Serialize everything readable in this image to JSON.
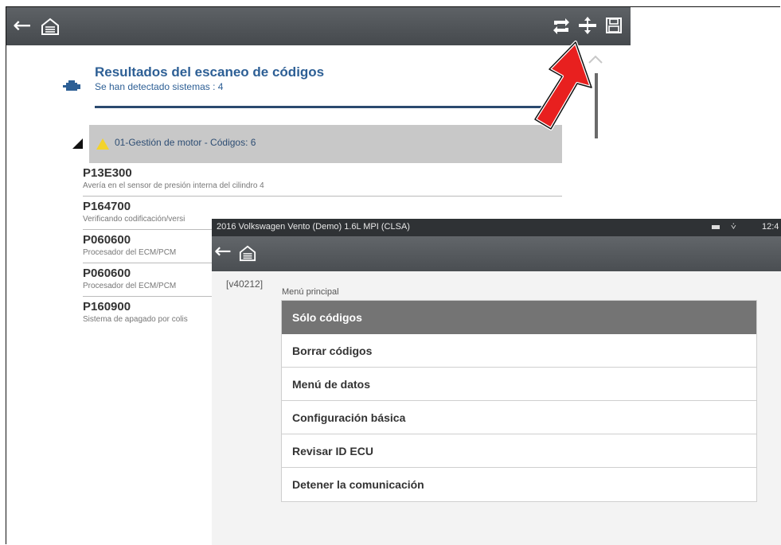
{
  "background_screen": {
    "toolbar": {
      "back_icon": "back-arrow-icon",
      "home_icon": "home-icon",
      "right_icons": [
        "refresh-icon",
        "expand-icon",
        "save-icon"
      ]
    },
    "scan": {
      "title": "Resultados del escaneo de códigos",
      "subtitle": "Se han detectado sistemas : 4"
    },
    "system": {
      "label": "01-Gestión de motor  - Códigos: 6"
    },
    "codes": [
      {
        "code": "P13E300",
        "desc": "Avería en el sensor de presión interna del cilindro 4"
      },
      {
        "code": "P164700",
        "desc": "Verificando codificación/versi"
      },
      {
        "code": "P060600",
        "desc": "Procesador del ECM/PCM"
      },
      {
        "code": "P060600",
        "desc": "Procesador del ECM/PCM"
      },
      {
        "code": "P160900",
        "desc": "Sistema de apagado por colis"
      }
    ]
  },
  "foreground_screen": {
    "status_bar": {
      "title": "2016 Volkswagen Vento (Demo) 1.6L MPI (CLSA)",
      "time": "12:4"
    },
    "version": "[v40212]",
    "menu_title": "Menú principal",
    "menu_items": [
      "Sólo códigos",
      "Borrar códigos",
      "Menú de datos",
      "Configuración básica",
      "Revisar ID ECU",
      "Detener la comunicación"
    ],
    "selected_index": 0
  },
  "colors": {
    "toolbar": "#505458",
    "header_text": "#2d5f95",
    "selected_item": "#747474",
    "warning": "#f3d32c",
    "callout_arrow": "#e8201f"
  }
}
